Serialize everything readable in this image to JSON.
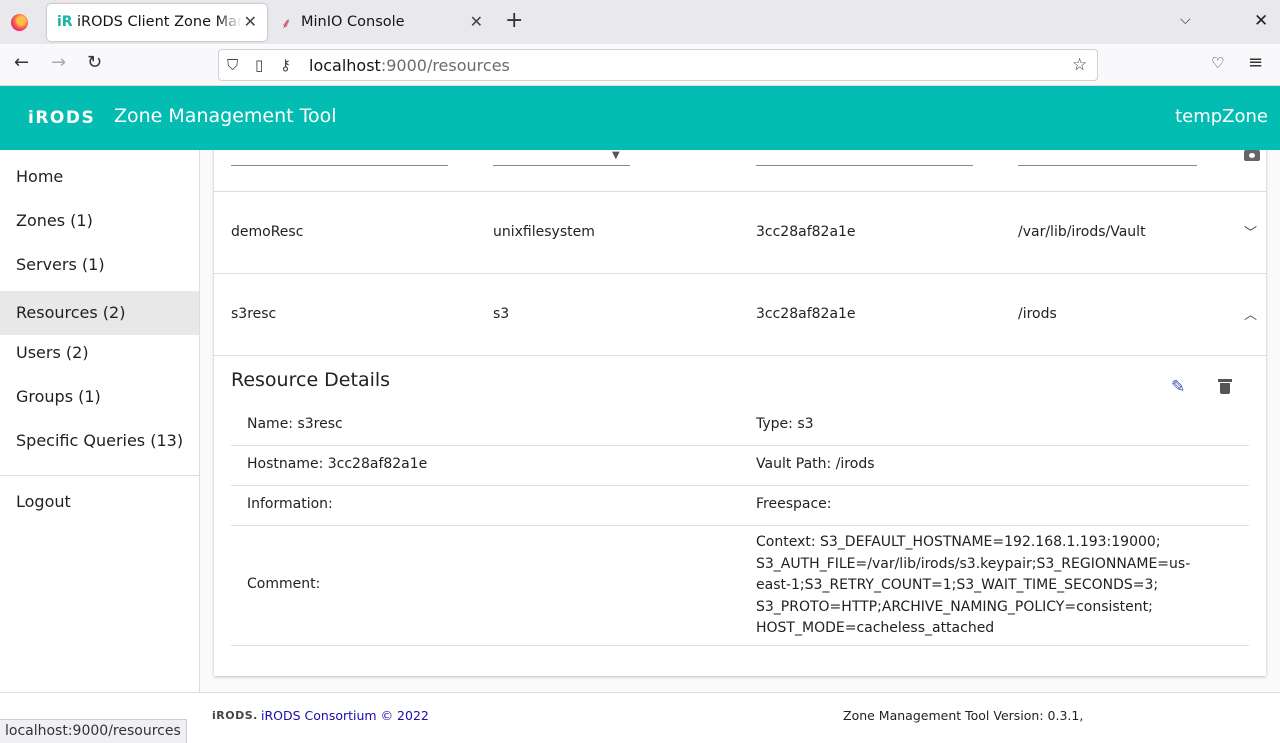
{
  "browser": {
    "tabs": [
      {
        "favicon": "iR",
        "title": "iRODS Client Zone Management Tool"
      },
      {
        "favicon": "⸙",
        "title": "MinIO Console"
      }
    ],
    "url_host": "localhost",
    "url_path": ":9000/resources",
    "status_url": "localhost:9000/resources"
  },
  "header": {
    "logo": "iRODS",
    "title": "Zone Management Tool",
    "zone": "tempZone"
  },
  "sidebar": {
    "items": [
      {
        "label": "Home"
      },
      {
        "label": "Zones (1)"
      },
      {
        "label": "Servers (1)"
      },
      {
        "label": "Resources (2)"
      },
      {
        "label": "Users (2)"
      },
      {
        "label": "Groups (1)"
      },
      {
        "label": "Specific Queries (13)"
      }
    ],
    "logout": "Logout"
  },
  "resources": [
    {
      "name": "demoResc",
      "type": "unixfilesystem",
      "host": "3cc28af82a1e",
      "vault": "/var/lib/irods/Vault",
      "expanded": false
    },
    {
      "name": "s3resc",
      "type": "s3",
      "host": "3cc28af82a1e",
      "vault": "/irods",
      "expanded": true
    }
  ],
  "details": {
    "title": "Resource Details",
    "name": "Name: s3resc",
    "type": "Type: s3",
    "hostname": "Hostname: 3cc28af82a1e",
    "vault_path": "Vault Path: /irods",
    "information": "Information:",
    "freespace": "Freespace:",
    "comment_label": "Comment:",
    "context": "Context: S3_DEFAULT_HOSTNAME=192.168.1.193:19000; S3_AUTH_FILE=/var/lib/irods/s3.keypair;S3_REGIONNAME=us-east-1;S3_RETRY_COUNT=1;S3_WAIT_TIME_SECONDS=3; S3_PROTO=HTTP;ARCHIVE_NAMING_POLICY=consistent; HOST_MODE=cacheless_attached"
  },
  "footer": {
    "logo": "iRODS.",
    "link": "iRODS Consortium © 2022",
    "version": "Zone Management Tool Version: 0.3.1,"
  }
}
